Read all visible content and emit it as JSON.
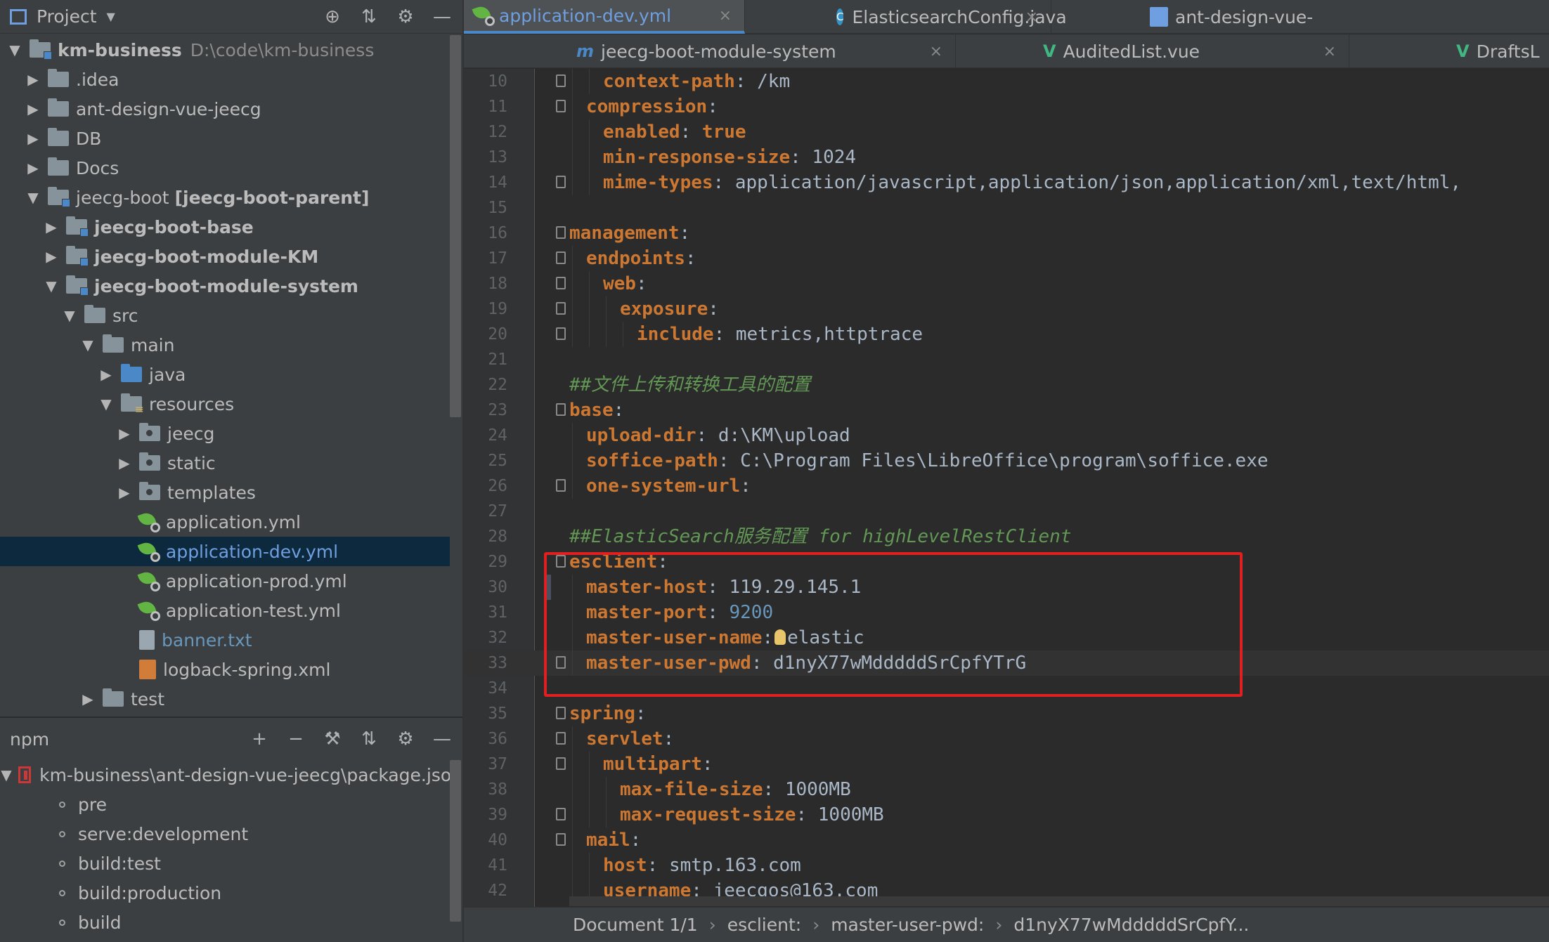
{
  "project_panel": {
    "title": "Project",
    "tree": [
      {
        "label": "km-business",
        "extra": "D:\\code\\km-business",
        "depth": 0,
        "arrow": "down",
        "icon": "module-folder",
        "bold": true
      },
      {
        "label": ".idea",
        "depth": 1,
        "arrow": "right",
        "icon": "folder"
      },
      {
        "label": "ant-design-vue-jeecg",
        "depth": 1,
        "arrow": "right",
        "icon": "folder"
      },
      {
        "label": "DB",
        "depth": 1,
        "arrow": "right",
        "icon": "folder"
      },
      {
        "label": "Docs",
        "depth": 1,
        "arrow": "right",
        "icon": "folder"
      },
      {
        "label": "jeecg-boot",
        "extra_bold": "[jeecg-boot-parent]",
        "depth": 1,
        "arrow": "down",
        "icon": "module-folder"
      },
      {
        "label": "jeecg-boot-base",
        "depth": 2,
        "arrow": "right",
        "icon": "module-folder",
        "bold": true
      },
      {
        "label": "jeecg-boot-module-KM",
        "depth": 2,
        "arrow": "right",
        "icon": "module-folder",
        "bold": true
      },
      {
        "label": "jeecg-boot-module-system",
        "depth": 2,
        "arrow": "down",
        "icon": "module-folder",
        "bold": true
      },
      {
        "label": "src",
        "depth": 3,
        "arrow": "down",
        "icon": "folder"
      },
      {
        "label": "main",
        "depth": 4,
        "arrow": "down",
        "icon": "folder"
      },
      {
        "label": "java",
        "depth": 5,
        "arrow": "right",
        "icon": "blue-folder"
      },
      {
        "label": "resources",
        "depth": 5,
        "arrow": "down",
        "icon": "resources-folder"
      },
      {
        "label": "jeecg",
        "depth": 6,
        "arrow": "right",
        "icon": "package-folder"
      },
      {
        "label": "static",
        "depth": 6,
        "arrow": "right",
        "icon": "package-folder"
      },
      {
        "label": "templates",
        "depth": 6,
        "arrow": "right",
        "icon": "package-folder"
      },
      {
        "label": "application.yml",
        "depth": 6,
        "arrow": "none",
        "icon": "spring-yml"
      },
      {
        "label": "application-dev.yml",
        "depth": 6,
        "arrow": "none",
        "icon": "spring-yml",
        "selected": true
      },
      {
        "label": "application-prod.yml",
        "depth": 6,
        "arrow": "none",
        "icon": "spring-yml"
      },
      {
        "label": "application-test.yml",
        "depth": 6,
        "arrow": "none",
        "icon": "spring-yml"
      },
      {
        "label": "banner.txt",
        "depth": 6,
        "arrow": "none",
        "icon": "text-file",
        "color": "blue"
      },
      {
        "label": "logback-spring.xml",
        "depth": 6,
        "arrow": "none",
        "icon": "xml-file"
      },
      {
        "label": "test",
        "depth": 4,
        "arrow": "right",
        "icon": "folder"
      }
    ],
    "header_icons": [
      "locate-icon",
      "collapse-all-icon",
      "gear-icon",
      "minimize-icon"
    ]
  },
  "npm_panel": {
    "title": "npm",
    "header_icons": [
      "add-icon",
      "remove-icon",
      "wrench-icon",
      "collapse-all-icon",
      "gear-icon",
      "minimize-icon"
    ],
    "package": "km-business\\ant-design-vue-jeecg\\package.json",
    "scripts": [
      "pre",
      "serve:development",
      "build:test",
      "build:production",
      "build"
    ]
  },
  "editor_tabs": {
    "row1": [
      {
        "label": "application-dev.yml",
        "icon": "spring-yml-icon",
        "active": true
      },
      {
        "label": "ElasticsearchConfig.java",
        "icon": "class-icon"
      },
      {
        "label": "ant-design-vue-",
        "icon": "markdown-icon"
      }
    ],
    "row2": [
      {
        "label": "jeecg-boot-module-system",
        "icon": "maven-icon",
        "glyph": "m"
      },
      {
        "label": "AuditedList.vue",
        "icon": "vue-icon",
        "glyph": "V"
      },
      {
        "label": "DraftsL",
        "icon": "vue-icon",
        "glyph": "V"
      }
    ]
  },
  "code_lines": [
    {
      "n": "10",
      "indent": 2,
      "key": "context-path",
      "value": "/km"
    },
    {
      "n": "11",
      "indent": 1,
      "key": "compression",
      "value": ""
    },
    {
      "n": "12",
      "indent": 2,
      "key": "enabled",
      "value": "true",
      "vtype": "bool"
    },
    {
      "n": "13",
      "indent": 2,
      "key": "min-response-size",
      "value": "1024"
    },
    {
      "n": "14",
      "indent": 2,
      "key": "mime-types",
      "value": "application/javascript,application/json,application/xml,text/html,"
    },
    {
      "n": "15"
    },
    {
      "n": "16",
      "indent": 0,
      "key": "management",
      "value": ""
    },
    {
      "n": "17",
      "indent": 1,
      "key": "endpoints",
      "value": ""
    },
    {
      "n": "18",
      "indent": 2,
      "key": "web",
      "value": ""
    },
    {
      "n": "19",
      "indent": 3,
      "key": "exposure",
      "value": ""
    },
    {
      "n": "20",
      "indent": 4,
      "key": "include",
      "value": "metrics,httptrace"
    },
    {
      "n": "21"
    },
    {
      "n": "22",
      "comment": "##文件上传和转换工具的配置"
    },
    {
      "n": "23",
      "indent": 0,
      "key": "base",
      "value": ""
    },
    {
      "n": "24",
      "indent": 1,
      "key": "upload-dir",
      "value": "d:\\KM\\upload"
    },
    {
      "n": "25",
      "indent": 1,
      "key": "soffice-path",
      "value": "C:\\Program Files\\LibreOffice\\program\\soffice.exe"
    },
    {
      "n": "26",
      "indent": 1,
      "key": "one-system-url",
      "value": ""
    },
    {
      "n": "27"
    },
    {
      "n": "28",
      "comment": "##ElasticSearch服务配置 for highLevelRestClient"
    },
    {
      "n": "29",
      "indent": 0,
      "key": "esclient",
      "value": ""
    },
    {
      "n": "30",
      "indent": 1,
      "key": "master-host",
      "value": "119.29.145.1"
    },
    {
      "n": "31",
      "indent": 1,
      "key": "master-port",
      "value": "9200",
      "vtype": "num"
    },
    {
      "n": "32",
      "indent": 1,
      "key": "master-user-name",
      "value": "elastic",
      "bulb": true
    },
    {
      "n": "33",
      "indent": 1,
      "key": "master-user-pwd",
      "value": "d1nyX77wMdddddSrCpfYTrG",
      "current": true
    },
    {
      "n": "34"
    },
    {
      "n": "35",
      "indent": 0,
      "key": "spring",
      "value": ""
    },
    {
      "n": "36",
      "indent": 1,
      "key": "servlet",
      "value": ""
    },
    {
      "n": "37",
      "indent": 2,
      "key": "multipart",
      "value": ""
    },
    {
      "n": "38",
      "indent": 3,
      "key": "max-file-size",
      "value": "1000MB"
    },
    {
      "n": "39",
      "indent": 3,
      "key": "max-request-size",
      "value": "1000MB"
    },
    {
      "n": "40",
      "indent": 1,
      "key": "mail",
      "value": ""
    },
    {
      "n": "41",
      "indent": 2,
      "key": "host",
      "value": "smtp.163.com"
    },
    {
      "n": "42",
      "indent": 2,
      "key": "username",
      "value": "jeecgos@163.com"
    }
  ],
  "breadcrumb": {
    "items": [
      "Document 1/1",
      "esclient:",
      "master-user-pwd:",
      "d1nyX77wMdddddSrCpfY..."
    ],
    "separator": "›"
  },
  "colors": {
    "highlight_box": "#e02020",
    "selection": "#0d293e",
    "yaml_key": "#cc7832",
    "comment": "#629755"
  }
}
